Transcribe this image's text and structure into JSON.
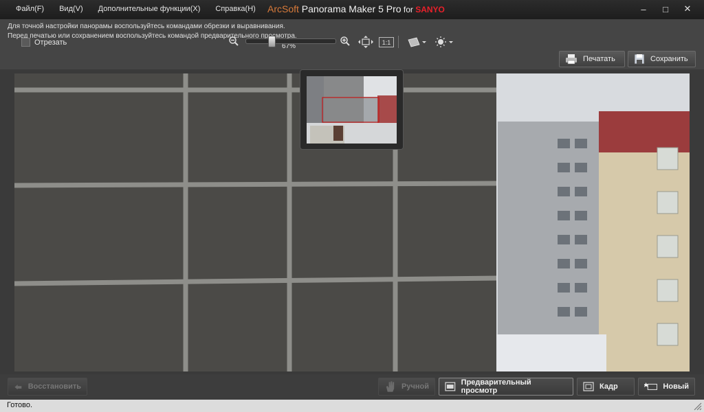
{
  "menu": {
    "items": [
      "Файл(F)",
      "Вид(V)",
      "Дополнительные функции(X)",
      "Справка(H)"
    ]
  },
  "title": {
    "brand": "ArcSoft",
    "product": " Panorama Maker 5 Pro",
    "for": " for ",
    "oem": "SANYO"
  },
  "window_buttons": {
    "minimize": "–",
    "maximize": "□",
    "close": "✕"
  },
  "hint": {
    "line1": "Для точной настройки панорамы воспользуйтесь командами обрезки и выравнивания.",
    "line2": "Перед печатью или сохранением воспользуйтесь командой предварительного просмотра."
  },
  "crop": {
    "label": "Отрезать",
    "checked": false
  },
  "zoom": {
    "value_label": "67%",
    "value": 0.67
  },
  "toolbar": {
    "print_label": "Печатать",
    "save_label": "Сохранить",
    "actual_size_label": "1:1"
  },
  "bottom": {
    "restore_label": "Восстановить",
    "manual_label": "Ручной",
    "preview_label": "Предварительный просмотр",
    "frame_label": "Кадр",
    "new_label": "Новый"
  },
  "status": {
    "text": "Готово."
  },
  "colors": {
    "oem": "#e8202a",
    "brand": "#d87a3a"
  }
}
